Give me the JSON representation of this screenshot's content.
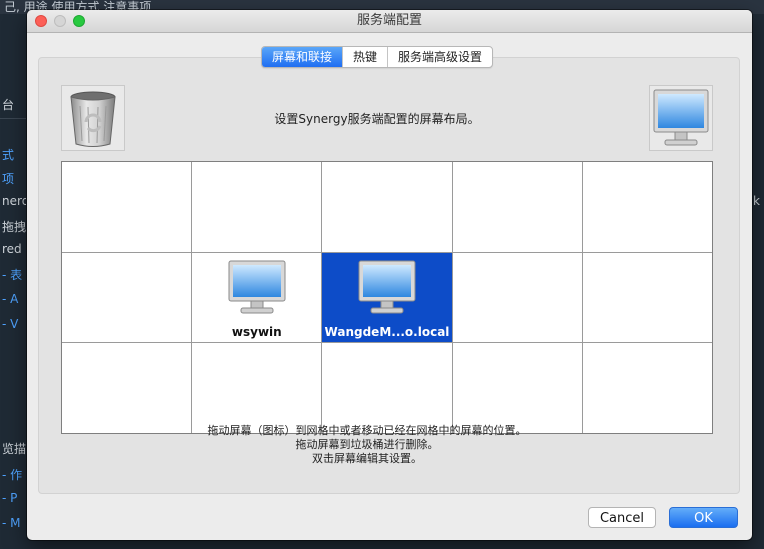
{
  "background": {
    "top_text": "己, 用途    使用方式    注意事项",
    "left_fragments": [
      "台",
      "式",
      "项",
      "nerd",
      "拖拽",
      "red",
      "- 表",
      "- A",
      "- V",
      "览描",
      "- 作",
      "- P",
      "- M"
    ],
    "right_fragments": [
      "k"
    ]
  },
  "window": {
    "title": "服务端配置"
  },
  "tabs": [
    {
      "label": "屏幕和联接",
      "active": true
    },
    {
      "label": "热键",
      "active": false
    },
    {
      "label": "服务端高级设置",
      "active": false
    }
  ],
  "description": "设置Synergy服务端配置的屏幕布局。",
  "trash": {
    "icon": "trash-can-icon"
  },
  "monitor_source": {
    "icon": "monitor-icon"
  },
  "grid": {
    "columns": 5,
    "rows": 3,
    "screens": [
      {
        "name": "wsywin",
        "row": 2,
        "col": 2,
        "selected": false
      },
      {
        "name": "WangdeM...o.local",
        "row": 2,
        "col": 3,
        "selected": true
      }
    ]
  },
  "hints": [
    "拖动屏幕（图标）到网格中或者移动已经在网格中的屏幕的位置。",
    "拖动屏幕到垃圾桶进行删除。",
    "双击屏幕编辑其设置。"
  ],
  "buttons": {
    "cancel": "Cancel",
    "ok": "OK"
  },
  "colors": {
    "accent": "#1f6ef2",
    "selection": "#0d4cc8"
  }
}
